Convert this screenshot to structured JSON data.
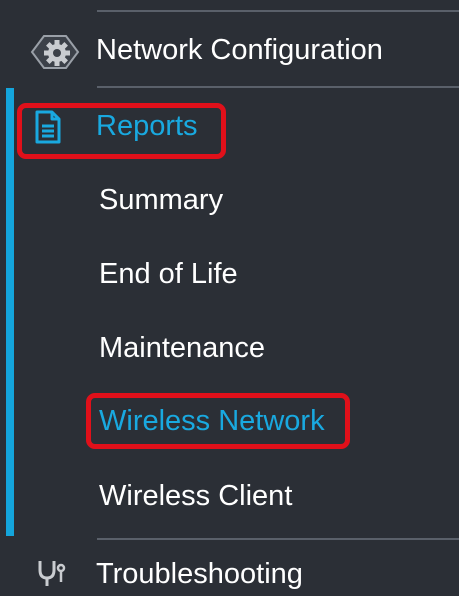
{
  "menu": {
    "network_configuration": {
      "label": "Network Configuration",
      "icon": "gear-icon"
    },
    "reports": {
      "label": "Reports",
      "icon": "document-icon",
      "expanded": true,
      "highlighted": true,
      "items": [
        {
          "label": "Summary",
          "selected": false
        },
        {
          "label": "End of Life",
          "selected": false
        },
        {
          "label": "Maintenance",
          "selected": false
        },
        {
          "label": "Wireless Network",
          "selected": true,
          "highlighted": true
        },
        {
          "label": "Wireless Client",
          "selected": false
        }
      ]
    },
    "troubleshooting": {
      "label": "Troubleshooting",
      "icon": "stethoscope-icon"
    }
  },
  "colors": {
    "background": "#2b2f36",
    "accent": "#19a9e0",
    "highlight_border": "#e0101a",
    "text": "#ffffff"
  }
}
